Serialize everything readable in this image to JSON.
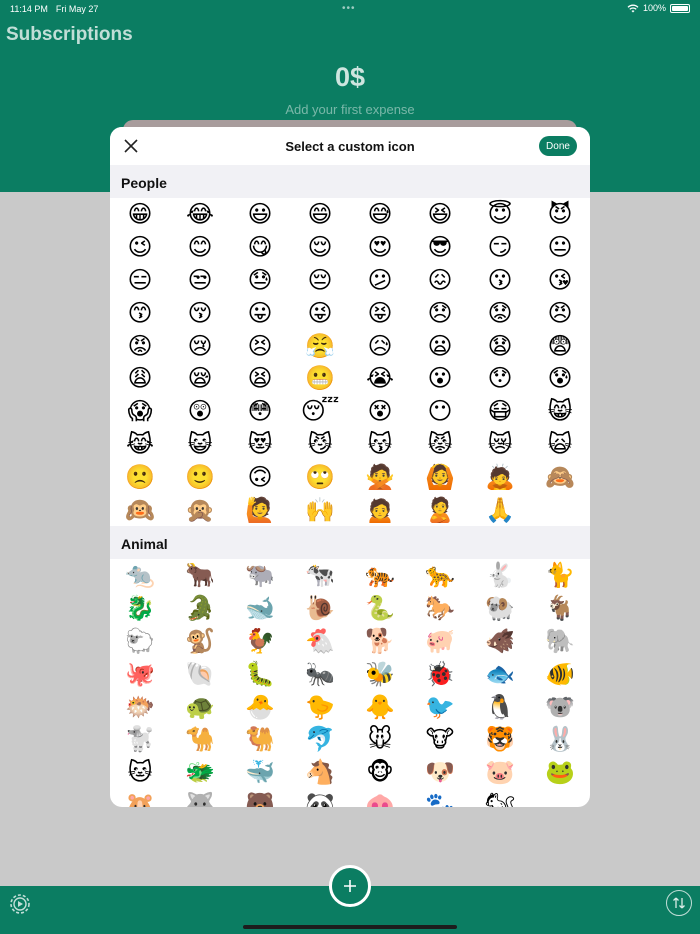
{
  "status_bar": {
    "time": "11:14 PM",
    "date": "Fri May 27",
    "battery": "100%"
  },
  "app": {
    "title": "Subscriptions",
    "total": "0$",
    "hint": "Add your first expense"
  },
  "modal": {
    "title": "Select a custom icon",
    "done_label": "Done",
    "sections": [
      {
        "name": "People",
        "emojis": [
          "😁",
          "😂",
          "😃",
          "😄",
          "😅",
          "😆",
          "😇",
          "😈",
          "😉",
          "😊",
          "😋",
          "😌",
          "😍",
          "😎",
          "😏",
          "😐",
          "😑",
          "😒",
          "😓",
          "😔",
          "😕",
          "😖",
          "😗",
          "😘",
          "😙",
          "😚",
          "😛",
          "😜",
          "😝",
          "😞",
          "😟",
          "😠",
          "😡",
          "😢",
          "😣",
          "😤",
          "😥",
          "😦",
          "😧",
          "😨",
          "😩",
          "😪",
          "😫",
          "😬",
          "😭",
          "😮",
          "😯",
          "😰",
          "😱",
          "😲",
          "😳",
          "😴",
          "😵",
          "😶",
          "😷",
          "😸",
          "😹",
          "😺",
          "😻",
          "😼",
          "😽",
          "😾",
          "😿",
          "🙀",
          "🙁",
          "🙂",
          "🙃",
          "🙄",
          "🙅",
          "🙆",
          "🙇",
          "🙈",
          "🙉",
          "🙊",
          "🙋",
          "🙌",
          "🙍",
          "🙎",
          "🙏"
        ]
      },
      {
        "name": "Animal",
        "emojis": [
          "🐀",
          "🐂",
          "🐃",
          "🐄",
          "🐅",
          "🐆",
          "🐇",
          "🐈",
          "🐉",
          "🐊",
          "🐋",
          "🐌",
          "🐍",
          "🐎",
          "🐏",
          "🐐",
          "🐑",
          "🐒",
          "🐓",
          "🐔",
          "🐕",
          "🐖",
          "🐗",
          "🐘",
          "🐙",
          "🐚",
          "🐛",
          "🐜",
          "🐝",
          "🐞",
          "🐟",
          "🐠",
          "🐡",
          "🐢",
          "🐣",
          "🐤",
          "🐥",
          "🐦",
          "🐧",
          "🐨",
          "🐩",
          "🐪",
          "🐫",
          "🐬",
          "🐭",
          "🐮",
          "🐯",
          "🐰",
          "🐱",
          "🐲",
          "🐳",
          "🐴",
          "🐵",
          "🐶",
          "🐷",
          "🐸",
          "🐹",
          "🐺",
          "🐻",
          "🐼",
          "🐽",
          "🐾",
          "🐿"
        ]
      }
    ]
  },
  "icons": {
    "close": "close-icon",
    "settings": "gear-icon",
    "sort": "sort-arrows-icon",
    "add": "plus-icon",
    "wifi": "wifi-icon",
    "battery": "battery-icon"
  },
  "colors": {
    "brand": "#0b7d62",
    "section_bg": "#f1f1f5",
    "backdrop": "#c9c9c9"
  }
}
